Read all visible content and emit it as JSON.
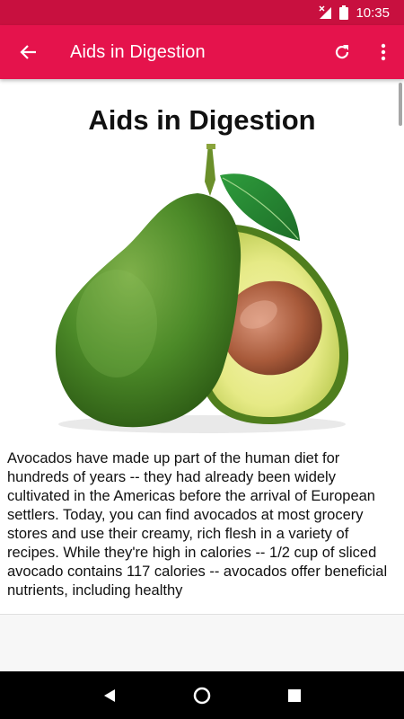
{
  "status_bar": {
    "time": "10:35",
    "icons": [
      "no-signal-icon",
      "battery-icon"
    ]
  },
  "app_bar": {
    "title": "Aids in Digestion",
    "back_icon": "arrow-back-icon",
    "actions": [
      "refresh-icon",
      "more-vert-icon"
    ]
  },
  "article": {
    "heading": "Aids in Digestion",
    "image": "avocado-image",
    "paragraph": "Avocados have made up part of the human diet for hundreds of years -- they had already been widely cultivated in the Americas before the arrival of European settlers. Today, you can find avocados at most grocery stores and use their creamy, rich flesh in a variety of recipes. While they're high in calories -- 1/2 cup of sliced avocado contains 117 calories -- avocados offer beneficial nutrients, including healthy"
  },
  "nav_bar": {
    "buttons": [
      "back-triangle-icon",
      "home-circle-icon",
      "recents-square-icon"
    ]
  },
  "colors": {
    "status_bar": "#c8103f",
    "app_bar": "#e5134c",
    "nav_bar": "#000000"
  }
}
